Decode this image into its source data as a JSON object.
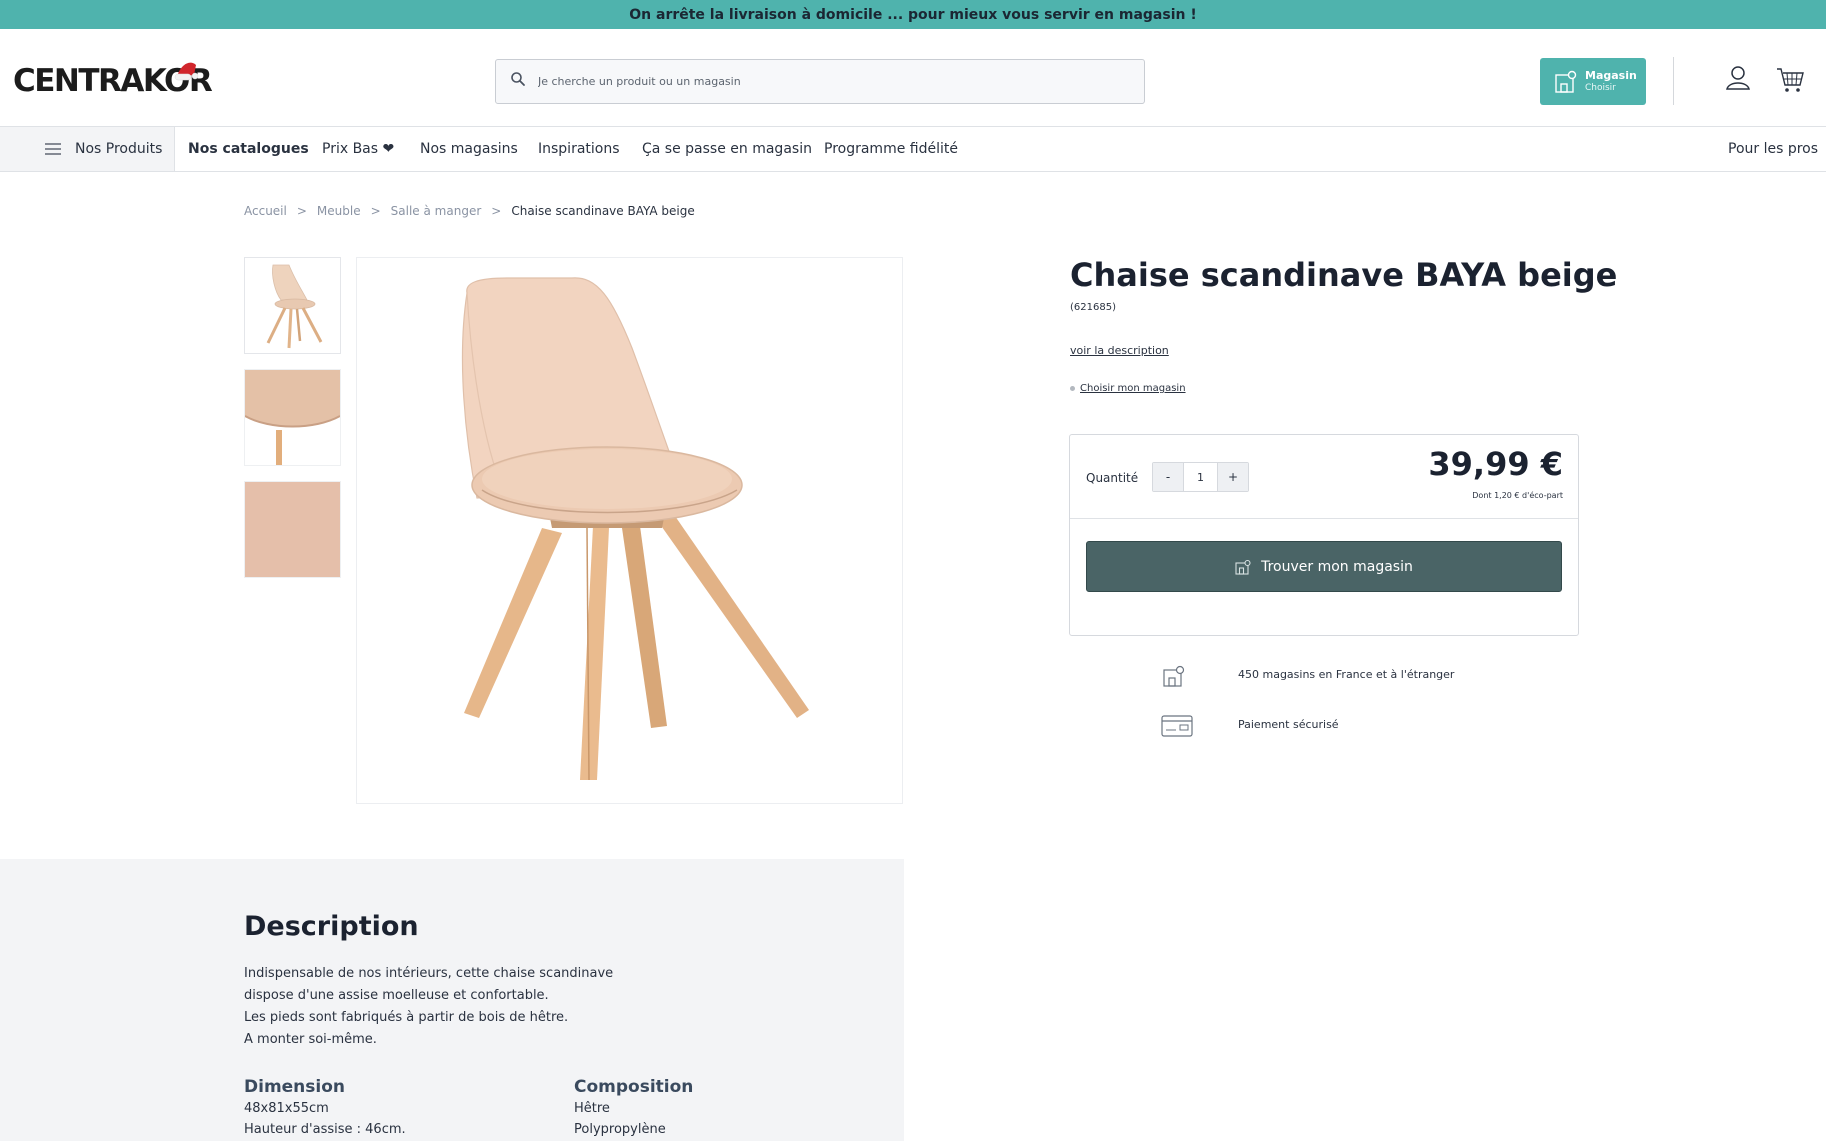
{
  "banner": {
    "text": "On arrête la livraison à domicile ... pour mieux vous servir en magasin !"
  },
  "header": {
    "logo": "CENTRAKOR",
    "search_placeholder": "Je cherche un produit ou un magasin",
    "store_button": {
      "title": "Magasin",
      "subtitle": "Choisir"
    },
    "icons": [
      "search-icon",
      "store-icon",
      "user-icon",
      "cart-icon"
    ]
  },
  "nav": {
    "products_label": "Nos Produits",
    "items": [
      "Nos catalogues",
      "Prix Bas ❤",
      "Nos magasins",
      "Inspirations",
      "Ça se passe en magasin",
      "Programme fidélité"
    ],
    "pro_link": "Pour les pros"
  },
  "breadcrumb": {
    "items": [
      "Accueil",
      "Meuble",
      "Salle à manger"
    ],
    "separator": ">",
    "current": "Chaise scandinave BAYA beige"
  },
  "product": {
    "title": "Chaise scandinave BAYA beige",
    "reference": "(621685)",
    "description_link": "voir la description",
    "choose_store_link": "Choisir mon magasin",
    "quantity_label": "Quantité",
    "quantity": {
      "minus": "-",
      "value": "1",
      "plus": "+"
    },
    "price": "39,99 €",
    "eco_part": "Dont 1,20 € d'éco-part",
    "cta": "Trouver mon magasin",
    "features": [
      {
        "icon": "store-icon",
        "text": "450 magasins en France et à l'étranger"
      },
      {
        "icon": "card-icon",
        "text": "Paiement sécurisé"
      }
    ]
  },
  "description": {
    "title": "Description",
    "lines": [
      "Indispensable de nos intérieurs, cette chaise scandinave",
      "dispose d'une assise moelleuse et confortable.",
      "Les pieds sont fabriqués à partir de bois de hêtre.",
      "A monter soi-même."
    ],
    "dimension": {
      "title": "Dimension",
      "lines": [
        "48x81x55cm",
        "Hauteur d'assise : 46cm."
      ]
    },
    "composition": {
      "title": "Composition",
      "lines": [
        "Hêtre",
        "Polypropylène"
      ]
    }
  },
  "colors": {
    "teal": "#4fb3ad",
    "cta": "#4a6466",
    "text": "#2a3240"
  }
}
